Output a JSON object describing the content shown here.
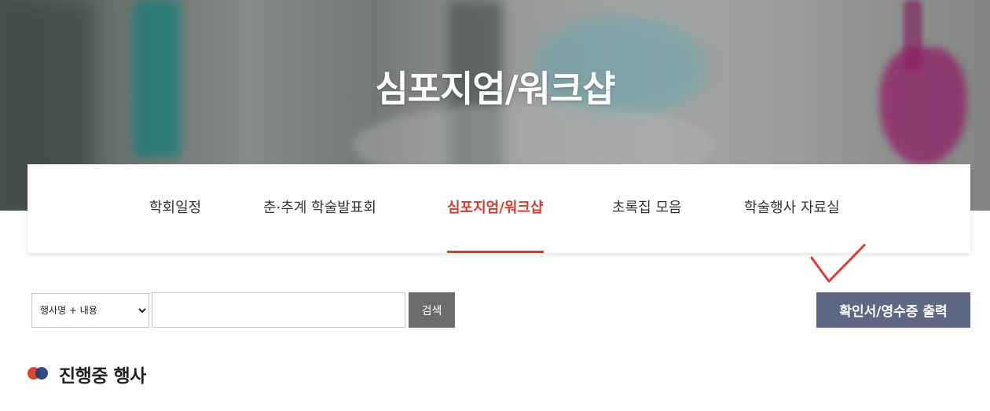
{
  "hero": {
    "title": "심포지엄/워크샵"
  },
  "tabs": [
    {
      "label": "학회일정",
      "active": false
    },
    {
      "label": "춘·추계 학술발표회",
      "active": false
    },
    {
      "label": "심포지엄/워크샵",
      "active": true
    },
    {
      "label": "초록집 모음",
      "active": false
    },
    {
      "label": "학술행사 자료실",
      "active": false
    }
  ],
  "search": {
    "selected_option": "행사명 + 내용",
    "input_value": "",
    "button_label": "검색"
  },
  "print_button_label": "확인서/영수증 출력",
  "section": {
    "title": "진행중 행사"
  },
  "colors": {
    "accent": "#d63c33",
    "print_button": "#5e6885",
    "search_button": "#6c6c6c",
    "bullet_left": "#e2442b",
    "bullet_right": "#1f3a7a",
    "check_mark": "#e03a2f"
  }
}
